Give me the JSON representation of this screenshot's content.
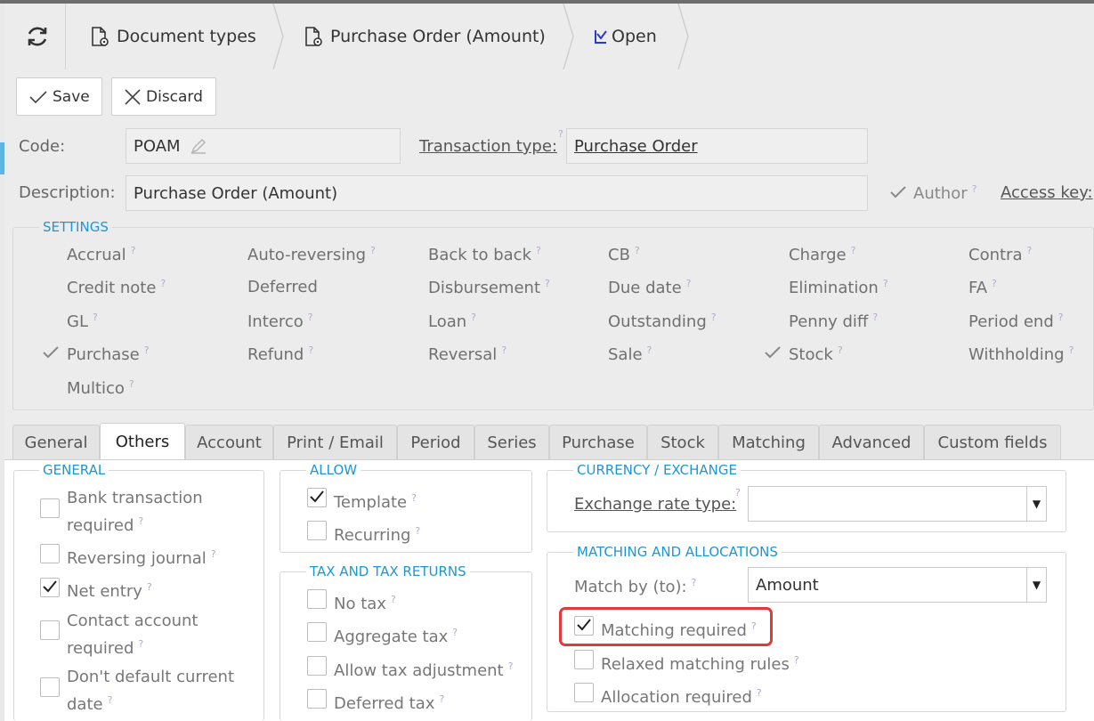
{
  "breadcrumb": {
    "items": [
      {
        "label": "Document types"
      },
      {
        "label": "Purchase Order (Amount)"
      },
      {
        "label": "Open"
      }
    ]
  },
  "toolbar": {
    "save_label": "Save",
    "discard_label": "Discard"
  },
  "form": {
    "code_label": "Code:",
    "code_value": "POAM",
    "transaction_type_label": "Transaction type:",
    "transaction_type_value": "Purchase Order",
    "description_label": "Description:",
    "description_value": "Purchase Order (Amount)",
    "author_label": "Author",
    "access_key_label": "Access key:"
  },
  "settings": {
    "legend": "SETTINGS",
    "items": [
      {
        "label": "Accrual",
        "checked": false
      },
      {
        "label": "Auto-reversing",
        "checked": false
      },
      {
        "label": "Back to back",
        "checked": false
      },
      {
        "label": "CB",
        "checked": false
      },
      {
        "label": "Charge",
        "checked": false
      },
      {
        "label": "Contra",
        "checked": false
      },
      {
        "label": "Credit note",
        "checked": false
      },
      {
        "label": "Deferred",
        "checked": false
      },
      {
        "label": "Disbursement",
        "checked": false
      },
      {
        "label": "Due date",
        "checked": false
      },
      {
        "label": "Elimination",
        "checked": false
      },
      {
        "label": "FA",
        "checked": false
      },
      {
        "label": "GL",
        "checked": false
      },
      {
        "label": "Interco",
        "checked": false
      },
      {
        "label": "Loan",
        "checked": false
      },
      {
        "label": "Outstanding",
        "checked": false
      },
      {
        "label": "Penny diff",
        "checked": false
      },
      {
        "label": "Period end",
        "checked": false
      },
      {
        "label": "Purchase",
        "checked": true
      },
      {
        "label": "Refund",
        "checked": false
      },
      {
        "label": "Reversal",
        "checked": false
      },
      {
        "label": "Sale",
        "checked": false
      },
      {
        "label": "Stock",
        "checked": true
      },
      {
        "label": "Withholding",
        "checked": false
      },
      {
        "label": "Multico",
        "checked": false
      }
    ]
  },
  "tabs": [
    {
      "label": "General"
    },
    {
      "label": "Others",
      "active": true
    },
    {
      "label": "Account"
    },
    {
      "label": "Print / Email"
    },
    {
      "label": "Period"
    },
    {
      "label": "Series"
    },
    {
      "label": "Purchase"
    },
    {
      "label": "Stock"
    },
    {
      "label": "Matching"
    },
    {
      "label": "Advanced"
    },
    {
      "label": "Custom fields"
    }
  ],
  "general": {
    "legend": "GENERAL",
    "items": [
      {
        "line1": "Bank transaction",
        "line2": "required",
        "checked": false
      },
      {
        "line1": "Reversing journal",
        "line2": "",
        "checked": false
      },
      {
        "line1": "Net entry",
        "line2": "",
        "checked": true
      },
      {
        "line1": "Contact account",
        "line2": "required",
        "checked": false
      },
      {
        "line1": "Don't default current",
        "line2": "date",
        "checked": false
      }
    ]
  },
  "allow": {
    "legend": "ALLOW",
    "items": [
      {
        "label": "Template",
        "checked": true
      },
      {
        "label": "Recurring",
        "checked": false
      }
    ]
  },
  "tax": {
    "legend": "TAX AND TAX RETURNS",
    "items": [
      {
        "label": "No tax",
        "checked": false
      },
      {
        "label": "Aggregate tax",
        "checked": false
      },
      {
        "label": "Allow tax adjustment",
        "checked": false
      },
      {
        "label": "Deferred tax",
        "checked": false
      }
    ]
  },
  "currency": {
    "legend": "CURRENCY / EXCHANGE",
    "exchange_rate_type_label": "Exchange rate type:",
    "exchange_rate_type_value": ""
  },
  "matching": {
    "legend": "MATCHING AND ALLOCATIONS",
    "match_by_label": "Match by (to):",
    "match_by_value": "Amount",
    "items": [
      {
        "label": "Matching required",
        "checked": true
      },
      {
        "label": "Relaxed matching rules",
        "checked": false
      },
      {
        "label": "Allocation required",
        "checked": false
      }
    ]
  },
  "colors": {
    "accent": "#1e96d3",
    "highlight": "#e03a3a"
  }
}
